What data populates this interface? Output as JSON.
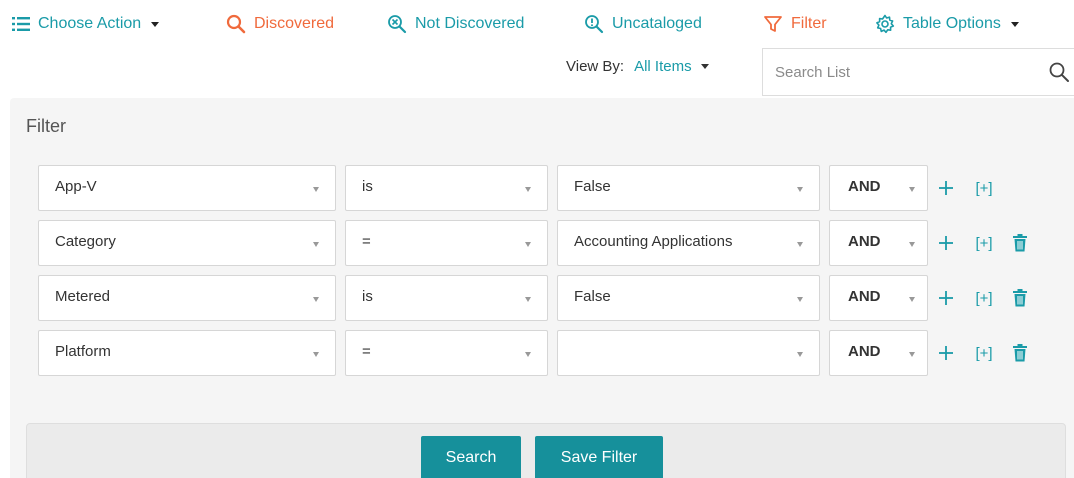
{
  "toolbar": {
    "choose_action": "Choose Action",
    "discovered": "Discovered",
    "not_discovered": "Not Discovered",
    "uncataloged": "Uncataloged",
    "filter": "Filter",
    "table_options": "Table Options",
    "colors": {
      "teal": "#1a9ba8",
      "orange": "#f06a3c"
    }
  },
  "view_by": {
    "label": "View By:",
    "value": "All Items"
  },
  "search": {
    "placeholder": "Search List",
    "value": ""
  },
  "filter": {
    "title": "Filter",
    "rows": [
      {
        "field": "App-V",
        "operator": "is",
        "value": "False",
        "conjunction": "AND",
        "deletable": false
      },
      {
        "field": "Category",
        "operator": "=",
        "value": "Accounting Applications",
        "conjunction": "AND",
        "deletable": true
      },
      {
        "field": "Metered",
        "operator": "is",
        "value": "False",
        "conjunction": "AND",
        "deletable": true
      },
      {
        "field": "Platform",
        "operator": "=",
        "value": "",
        "conjunction": "AND",
        "deletable": true
      }
    ],
    "add_label": "+",
    "group_label": "[+]",
    "search_button": "Search",
    "save_button": "Save Filter",
    "button_color": "#16909b"
  }
}
